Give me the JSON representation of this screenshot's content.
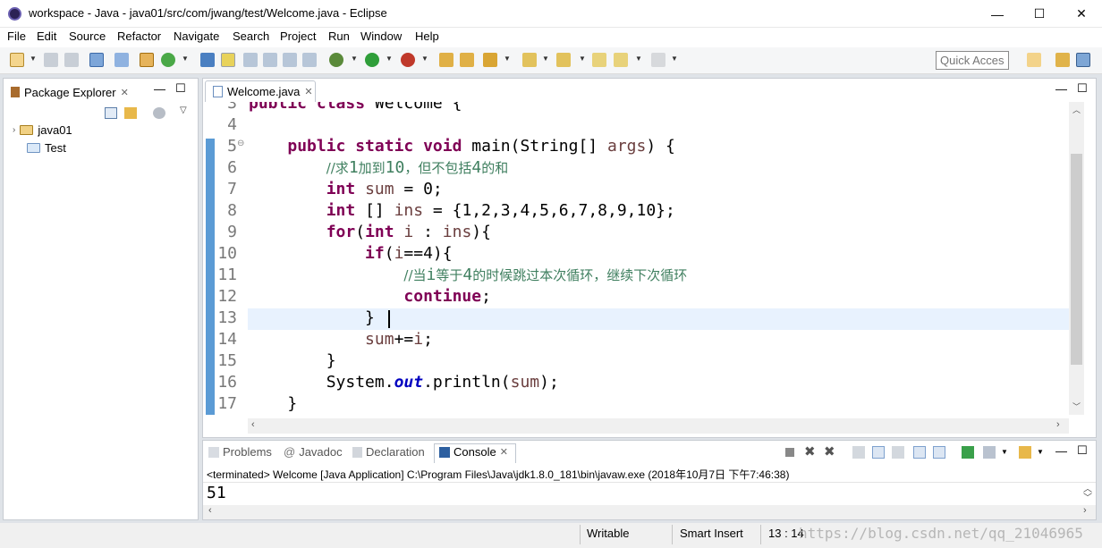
{
  "window": {
    "title": "workspace - Java - java01/src/com/jwang/test/Welcome.java - Eclipse",
    "minimize": "—",
    "maximize": "☐",
    "close": "✕"
  },
  "menu": [
    {
      "label": "File"
    },
    {
      "label": "Edit"
    },
    {
      "label": "Source"
    },
    {
      "label": "Refactor"
    },
    {
      "label": "Navigate"
    },
    {
      "label": "Search"
    },
    {
      "label": "Project"
    },
    {
      "label": "Run"
    },
    {
      "label": "Window"
    },
    {
      "label": "Help"
    }
  ],
  "toolbar": {
    "quick_access_placeholder": "Quick Access"
  },
  "package_explorer": {
    "title": "Package Explorer",
    "items": [
      {
        "label": "java01",
        "expandable": true
      },
      {
        "label": "Test",
        "expandable": false
      }
    ]
  },
  "editor": {
    "tab_label": "Welcome.java",
    "lines": [
      {
        "num": "3",
        "tokens": [
          {
            "t": "public ",
            "c": "kw"
          },
          {
            "t": "class ",
            "c": "kw"
          },
          {
            "t": "Welcome {",
            "c": ""
          }
        ]
      },
      {
        "num": "4",
        "tokens": []
      },
      {
        "num": "5",
        "tokens": [
          {
            "t": "    ",
            "c": ""
          },
          {
            "t": "public ",
            "c": "kw"
          },
          {
            "t": "static ",
            "c": "kw"
          },
          {
            "t": "void ",
            "c": "kw"
          },
          {
            "t": "main(String[] ",
            "c": ""
          },
          {
            "t": "args",
            "c": "var"
          },
          {
            "t": ") {",
            "c": ""
          }
        ]
      },
      {
        "num": "6",
        "tokens": [
          {
            "t": "        ",
            "c": ""
          },
          {
            "t": "//求",
            "c": "cm"
          },
          {
            "t": "1",
            "c": "cm-mono"
          },
          {
            "t": "加到",
            "c": "cm"
          },
          {
            "t": "10",
            "c": "cm-mono"
          },
          {
            "t": "，但不包括",
            "c": "cm"
          },
          {
            "t": "4",
            "c": "cm-mono"
          },
          {
            "t": "的和",
            "c": "cm"
          }
        ]
      },
      {
        "num": "7",
        "tokens": [
          {
            "t": "        ",
            "c": ""
          },
          {
            "t": "int ",
            "c": "kw"
          },
          {
            "t": "sum",
            "c": "var"
          },
          {
            "t": " = 0;",
            "c": ""
          }
        ]
      },
      {
        "num": "8",
        "tokens": [
          {
            "t": "        ",
            "c": ""
          },
          {
            "t": "int ",
            "c": "kw"
          },
          {
            "t": "[] ",
            "c": ""
          },
          {
            "t": "ins",
            "c": "var"
          },
          {
            "t": " = {1,2,3,4,5,6,7,8,9,10};",
            "c": ""
          }
        ]
      },
      {
        "num": "9",
        "tokens": [
          {
            "t": "        ",
            "c": ""
          },
          {
            "t": "for",
            "c": "kw"
          },
          {
            "t": "(",
            "c": ""
          },
          {
            "t": "int ",
            "c": "kw"
          },
          {
            "t": "i",
            "c": "var"
          },
          {
            "t": " : ",
            "c": ""
          },
          {
            "t": "ins",
            "c": "var"
          },
          {
            "t": "){",
            "c": ""
          }
        ]
      },
      {
        "num": "10",
        "tokens": [
          {
            "t": "            ",
            "c": ""
          },
          {
            "t": "if",
            "c": "kw"
          },
          {
            "t": "(",
            "c": ""
          },
          {
            "t": "i",
            "c": "var"
          },
          {
            "t": "==4){",
            "c": ""
          }
        ]
      },
      {
        "num": "11",
        "tokens": [
          {
            "t": "                ",
            "c": ""
          },
          {
            "t": "//当",
            "c": "cm"
          },
          {
            "t": "i",
            "c": "cm-mono"
          },
          {
            "t": "等于",
            "c": "cm"
          },
          {
            "t": "4",
            "c": "cm-mono"
          },
          {
            "t": "的时候跳过本次循环，继续下次循环",
            "c": "cm"
          }
        ]
      },
      {
        "num": "12",
        "tokens": [
          {
            "t": "                ",
            "c": ""
          },
          {
            "t": "continue",
            "c": "kw"
          },
          {
            "t": ";",
            "c": ""
          }
        ]
      },
      {
        "num": "13",
        "tokens": [
          {
            "t": "            }",
            "c": ""
          }
        ]
      },
      {
        "num": "14",
        "tokens": [
          {
            "t": "            ",
            "c": ""
          },
          {
            "t": "sum",
            "c": "var"
          },
          {
            "t": "+=",
            "c": ""
          },
          {
            "t": "i",
            "c": "var"
          },
          {
            "t": ";",
            "c": ""
          }
        ]
      },
      {
        "num": "15",
        "tokens": [
          {
            "t": "        }",
            "c": ""
          }
        ]
      },
      {
        "num": "16",
        "tokens": [
          {
            "t": "        System.",
            "c": ""
          },
          {
            "t": "out",
            "c": "fld"
          },
          {
            "t": ".println(",
            "c": ""
          },
          {
            "t": "sum",
            "c": "var"
          },
          {
            "t": ");",
            "c": ""
          }
        ]
      },
      {
        "num": "17",
        "tokens": [
          {
            "t": "    }",
            "c": ""
          }
        ]
      }
    ]
  },
  "console": {
    "tabs": [
      {
        "label": "Problems"
      },
      {
        "label": "Javadoc"
      },
      {
        "label": "Declaration"
      },
      {
        "label": "Console"
      }
    ],
    "status": "<terminated> Welcome [Java Application] C:\\Program Files\\Java\\jdk1.8.0_181\\bin\\javaw.exe (2018年10月7日 下午7:46:38)",
    "output": "51"
  },
  "statusbar": {
    "writable": "Writable",
    "insert_mode": "Smart Insert",
    "position": "13 : 14",
    "watermark": "https://blog.csdn.net/qq_21046965"
  },
  "colors": {
    "keyword": "#7f0055",
    "comment": "#3f7f5f",
    "variable": "#6a3e3e",
    "static_field": "#0000c0",
    "current_line": "#e8f2fe"
  }
}
